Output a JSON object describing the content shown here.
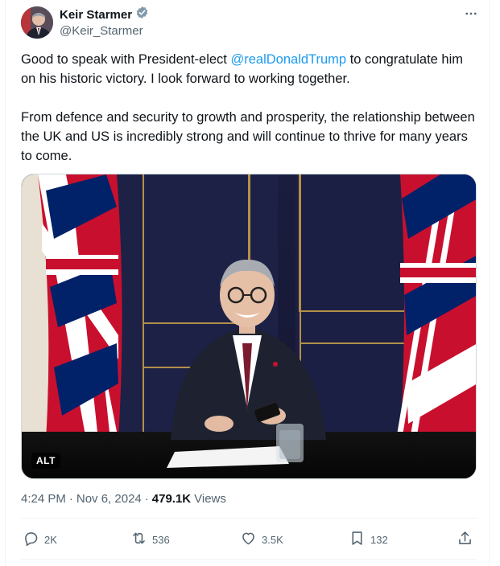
{
  "author": {
    "display_name": "Keir Starmer",
    "handle": "@Keir_Starmer",
    "verified_badge": "verified-badge-icon"
  },
  "more_icon": "more-options-icon",
  "tweet": {
    "line1_before": "Good to speak with President-elect ",
    "mention": "@realDonaldTrump",
    "line1_after": " to congratulate him on his historic victory. I look forward to working together.",
    "paragraph2": "From defence and security to growth and prosperity, the relationship between the UK and US is incredibly strong and will continue to thrive for many years to come."
  },
  "media": {
    "alt_badge": "ALT"
  },
  "meta": {
    "time": "4:24 PM",
    "separator1": "·",
    "date": "Nov 6, 2024",
    "separator2": "·",
    "views_count": "479.1K",
    "views_label": "Views"
  },
  "actions": {
    "replies": "2K",
    "reposts": "536",
    "likes": "3.5K",
    "bookmarks": "132"
  },
  "colors": {
    "accent": "#1d9bf0",
    "secondary_text": "#536471",
    "primary_text": "#0f1419"
  }
}
